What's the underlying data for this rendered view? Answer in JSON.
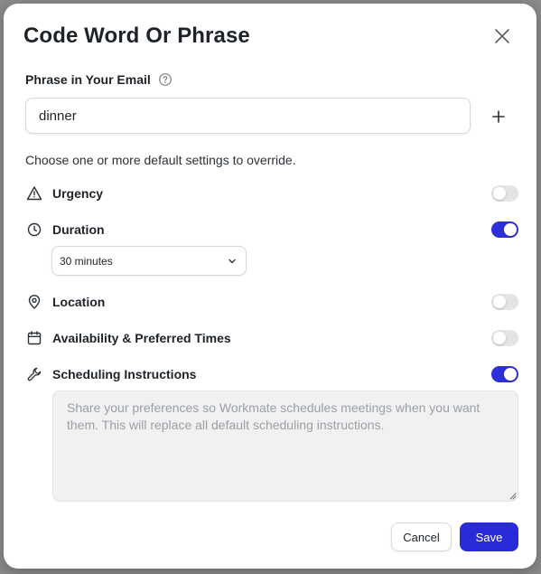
{
  "dialog": {
    "title": "Code Word Or Phrase",
    "close_icon": "close-icon"
  },
  "phrase": {
    "label": "Phrase in Your Email",
    "help_icon": "question-circle-icon",
    "value": "dinner",
    "add_icon": "plus-icon"
  },
  "hint": "Choose one or more default settings to override.",
  "settings": [
    {
      "label": "Urgency",
      "icon": "warning-triangle-icon",
      "enabled": false
    },
    {
      "label": "Duration",
      "icon": "clock-icon",
      "enabled": true
    },
    {
      "label": "Location",
      "icon": "map-pin-icon",
      "enabled": false
    },
    {
      "label": "Availability & Preferred Times",
      "icon": "calendar-icon",
      "enabled": false
    },
    {
      "label": "Scheduling Instructions",
      "icon": "wrench-icon",
      "enabled": true
    }
  ],
  "duration_select": {
    "value": "30 minutes",
    "icon": "chevron-down-icon"
  },
  "instructions": {
    "value": "",
    "placeholder": "Share your preferences so Workmate schedules meetings when you want them. This will replace all default scheduling instructions."
  },
  "buttons": {
    "cancel": "Cancel",
    "save": "Save"
  },
  "colors": {
    "accent": "#2a2ad9",
    "toggle_off": "#e3e4e6"
  }
}
